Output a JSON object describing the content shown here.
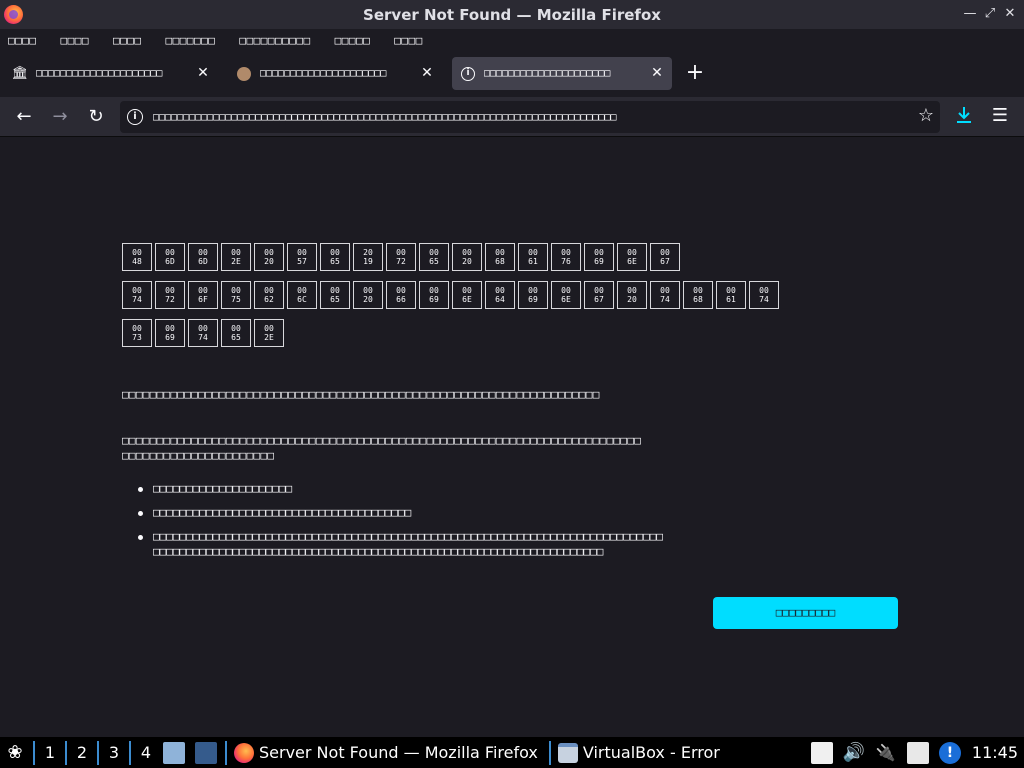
{
  "window": {
    "title": "Server Not Found — Mozilla Firefox"
  },
  "menubar": {
    "items": [
      "□□□□",
      "□□□□",
      "□□□□",
      "□□□□□□□",
      "□□□□□□□□□□",
      "□□□□□",
      "□□□□"
    ]
  },
  "tabs": [
    {
      "icon": "museum-icon",
      "title": "□□□□□□□□□□□□□□□□□□□□□",
      "active": false
    },
    {
      "icon": "avatar-icon",
      "title": "□□□□□□□□□□□□□□□□□□□□□",
      "active": false
    },
    {
      "icon": "info-icon",
      "title": "□□□□□□□□□□□□□□□□□□□□□",
      "active": true
    }
  ],
  "urlbar": {
    "value": "□□□□□□□□□□□□□□□□□□□□□□□□□□□□□□□□□□□□□□□□□□□□□□□□□□□□□□□□□□□□□□□□□□□□□□□□□□□□□"
  },
  "error_page": {
    "heading_rows": [
      [
        "00\n48",
        "00\n6D",
        "00\n6D",
        "00\n2E",
        "00\n20",
        "00\n57",
        "00\n65",
        "20\n19",
        "00\n72",
        "00\n65",
        "00\n20",
        "00\n68",
        "00\n61",
        "00\n76",
        "00\n69",
        "00\n6E",
        "00\n67"
      ],
      [
        "00\n74",
        "00\n72",
        "00\n6F",
        "00\n75",
        "00\n62",
        "00\n6C",
        "00\n65",
        "00\n20",
        "00\n66",
        "00\n69",
        "00\n6E",
        "00\n64",
        "00\n69",
        "00\n6E",
        "00\n67",
        "00\n20",
        "00\n74",
        "00\n68",
        "00\n61",
        "00\n74"
      ],
      [
        "00\n73",
        "00\n69",
        "00\n74",
        "00\n65",
        "00\n2E"
      ]
    ],
    "intro": "□□□□□□□□□□□□□□□□□□□□□□□□□□□□□□□□□□□□□□□□□□□□□□□□□□□□□□□□□□□□□□□□□□□□□",
    "explain_line1": "□□□□□□□□□□□□□□□□□□□□□□□□□□□□□□□□□□□□□□□□□□□□□□□□□□□□□□□□□□□□□□□□□□□□□□□□□□□",
    "explain_line2": "□□□□□□□□□□□□□□□□□□□□□□",
    "bullets": [
      "□□□□□□□□□□□□□□□□□□□□□",
      "□□□□□□□□□□□□□□□□□□□□□□□□□□□□□□□□□□□□□□□",
      "□□□□□□□□□□□□□□□□□□□□□□□□□□□□□□□□□□□□□□□□□□□□□□□□□□□□□□□□□□□□□□□□□□□□□□□□□□□□□\n□□□□□□□□□□□□□□□□□□□□□□□□□□□□□□□□□□□□□□□□□□□□□□□□□□□□□□□□□□□□□□□□□□□□"
    ],
    "try_again_label": "□□□□□□□□□"
  },
  "taskbar": {
    "workspaces": [
      "1",
      "2",
      "3",
      "4"
    ],
    "tasks": [
      {
        "label": "Server Not Found — Mozilla Firefox",
        "icon": "firefox-icon"
      },
      {
        "label": "VirtualBox - Error",
        "icon": "window-icon"
      }
    ],
    "clock": "11:45"
  },
  "colors": {
    "accent": "#00ddff",
    "background": "#1c1b22",
    "toolbar": "#2b2a33",
    "download": "#54ffbd"
  }
}
